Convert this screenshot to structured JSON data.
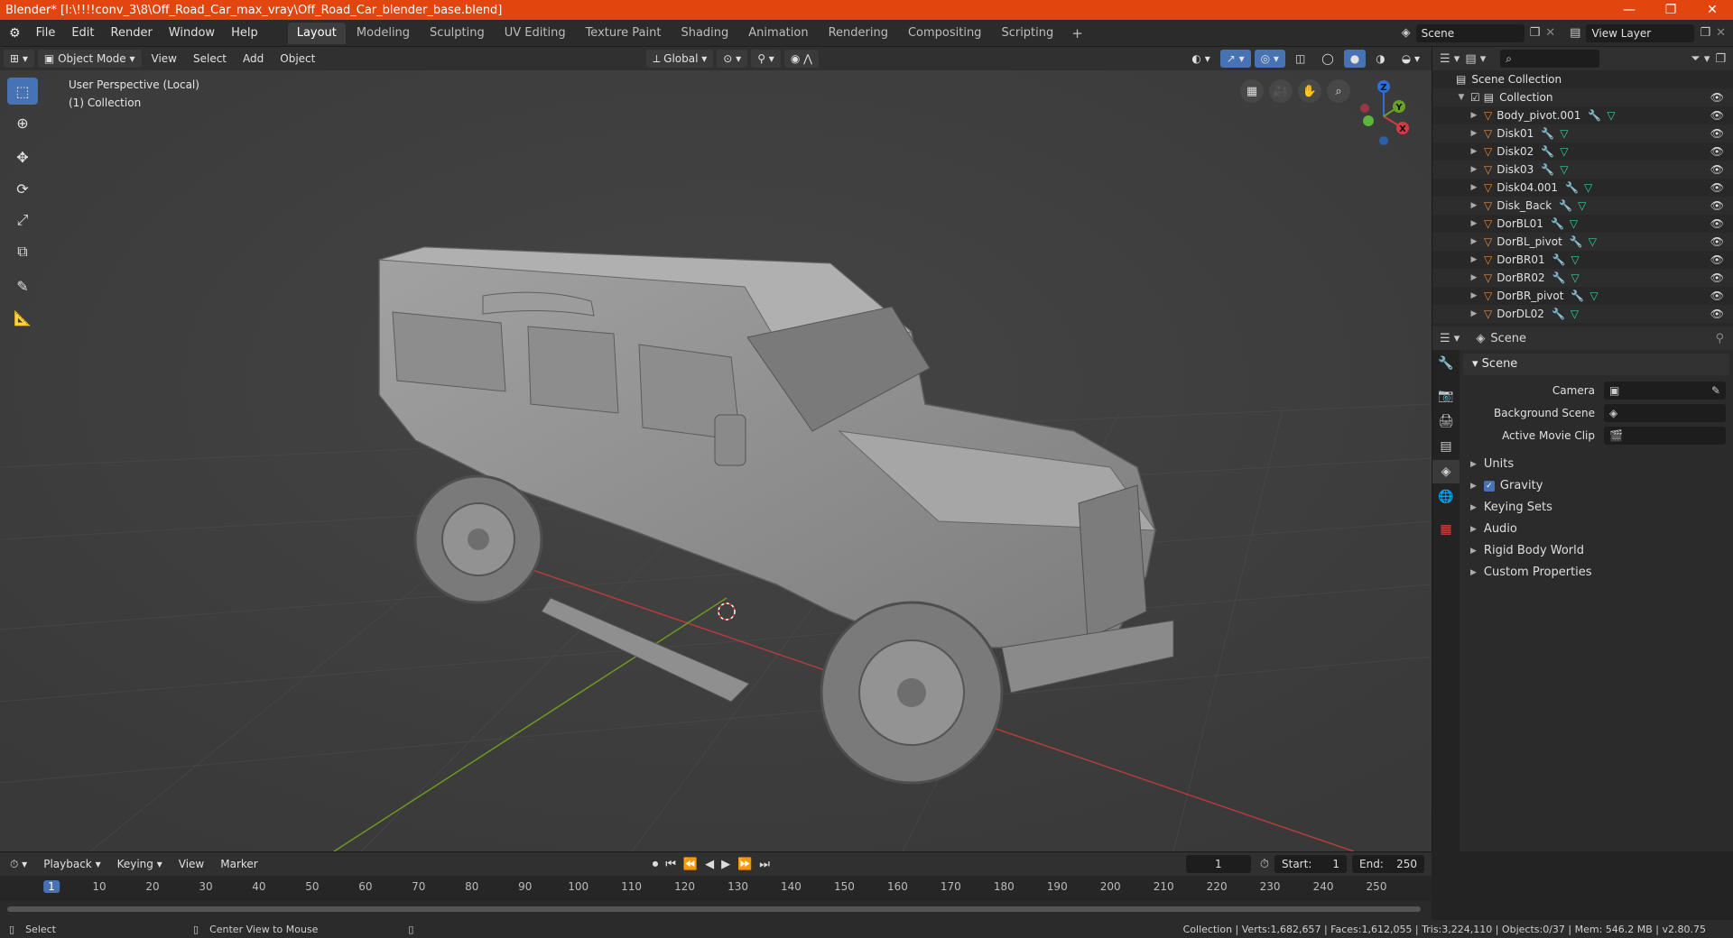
{
  "window": {
    "title": "Blender* [I:\\!!!!conv_3\\8\\Off_Road_Car_max_vray\\Off_Road_Car_blender_base.blend]",
    "controls": [
      "—",
      "❐",
      "✕"
    ]
  },
  "menu": [
    "File",
    "Edit",
    "Render",
    "Window",
    "Help"
  ],
  "workspaces": [
    "Layout",
    "Modeling",
    "Sculpting",
    "UV Editing",
    "Texture Paint",
    "Shading",
    "Animation",
    "Rendering",
    "Compositing",
    "Scripting"
  ],
  "active_workspace": "Layout",
  "scene_field": "Scene",
  "view_layer_field": "View Layer",
  "viewport_header": {
    "mode": "Object Mode",
    "menus": [
      "View",
      "Select",
      "Add",
      "Object"
    ],
    "transform": "Global"
  },
  "viewport": {
    "perspective_label": "User Perspective (Local)",
    "collection_label": "(1) Collection",
    "gizmo": {
      "z": "Z",
      "y": "Y",
      "x": "X"
    }
  },
  "outliner": {
    "root": "Scene Collection",
    "collection": "Collection",
    "objects": [
      "Body_pivot.001",
      "Disk01",
      "Disk02",
      "Disk03",
      "Disk04.001",
      "Disk_Back",
      "DorBL01",
      "DorBL_pivot",
      "DorBR01",
      "DorBR02",
      "DorBR_pivot",
      "DorDL02"
    ]
  },
  "properties": {
    "header": "Scene",
    "panel": "Scene",
    "camera_label": "Camera",
    "background_scene_label": "Background Scene",
    "active_clip_label": "Active Movie Clip",
    "sections": [
      "Units",
      "Gravity",
      "Keying Sets",
      "Audio",
      "Rigid Body World",
      "Custom Properties"
    ],
    "gravity_checked": true
  },
  "timeline": {
    "menus": [
      "Playback",
      "Keying",
      "View",
      "Marker"
    ],
    "current_frame": "1",
    "start_label": "Start:",
    "start": "1",
    "end_label": "End:",
    "end": "250",
    "ruler": [
      "1",
      "10",
      "20",
      "30",
      "40",
      "50",
      "60",
      "70",
      "80",
      "90",
      "100",
      "110",
      "120",
      "130",
      "140",
      "150",
      "160",
      "170",
      "180",
      "190",
      "200",
      "210",
      "220",
      "230",
      "240",
      "250"
    ]
  },
  "status": {
    "left1": "Select",
    "left2": "Center View to Mouse",
    "right": "Collection | Verts:1,682,657 | Faces:1,612,055 | Tris:3,224,110 | Objects:0/37 | Mem: 546.2 MB | v2.80.75"
  },
  "colors": {
    "accent": "#4772b3",
    "titlebar": "#e2450e",
    "object_icon": "#e8873a",
    "modifier_icon": "#6b9fe0",
    "mesh_icon": "#35d0a0"
  }
}
